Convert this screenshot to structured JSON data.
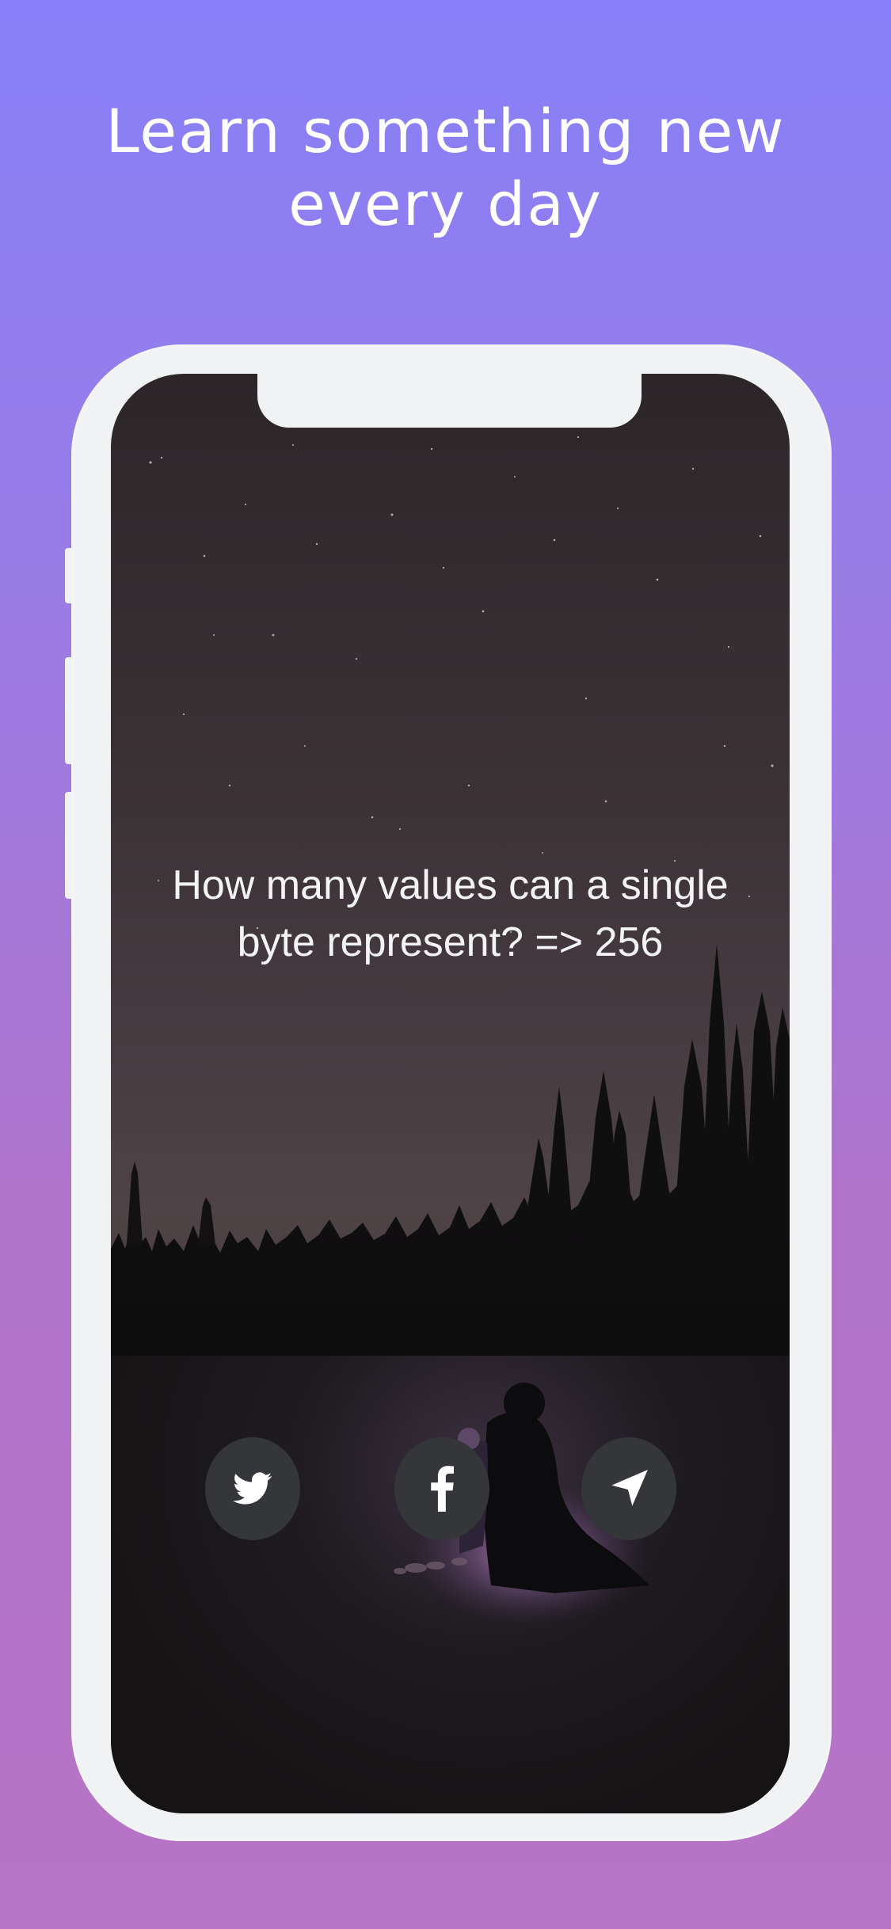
{
  "headline": {
    "line1": "Learn something new",
    "line2": "every day"
  },
  "card": {
    "question_text": "How many values can a single\nbyte represent?  =>  256"
  },
  "share_buttons": [
    {
      "icon": "twitter-icon"
    },
    {
      "icon": "facebook-icon"
    },
    {
      "icon": "send-arrow-icon"
    }
  ],
  "colors": {
    "background_top": "#8780f8",
    "background_bottom": "#b874c6",
    "phone_frame": "#f1f2f4",
    "button_fill": "#34363a",
    "text": "#ffffff"
  }
}
